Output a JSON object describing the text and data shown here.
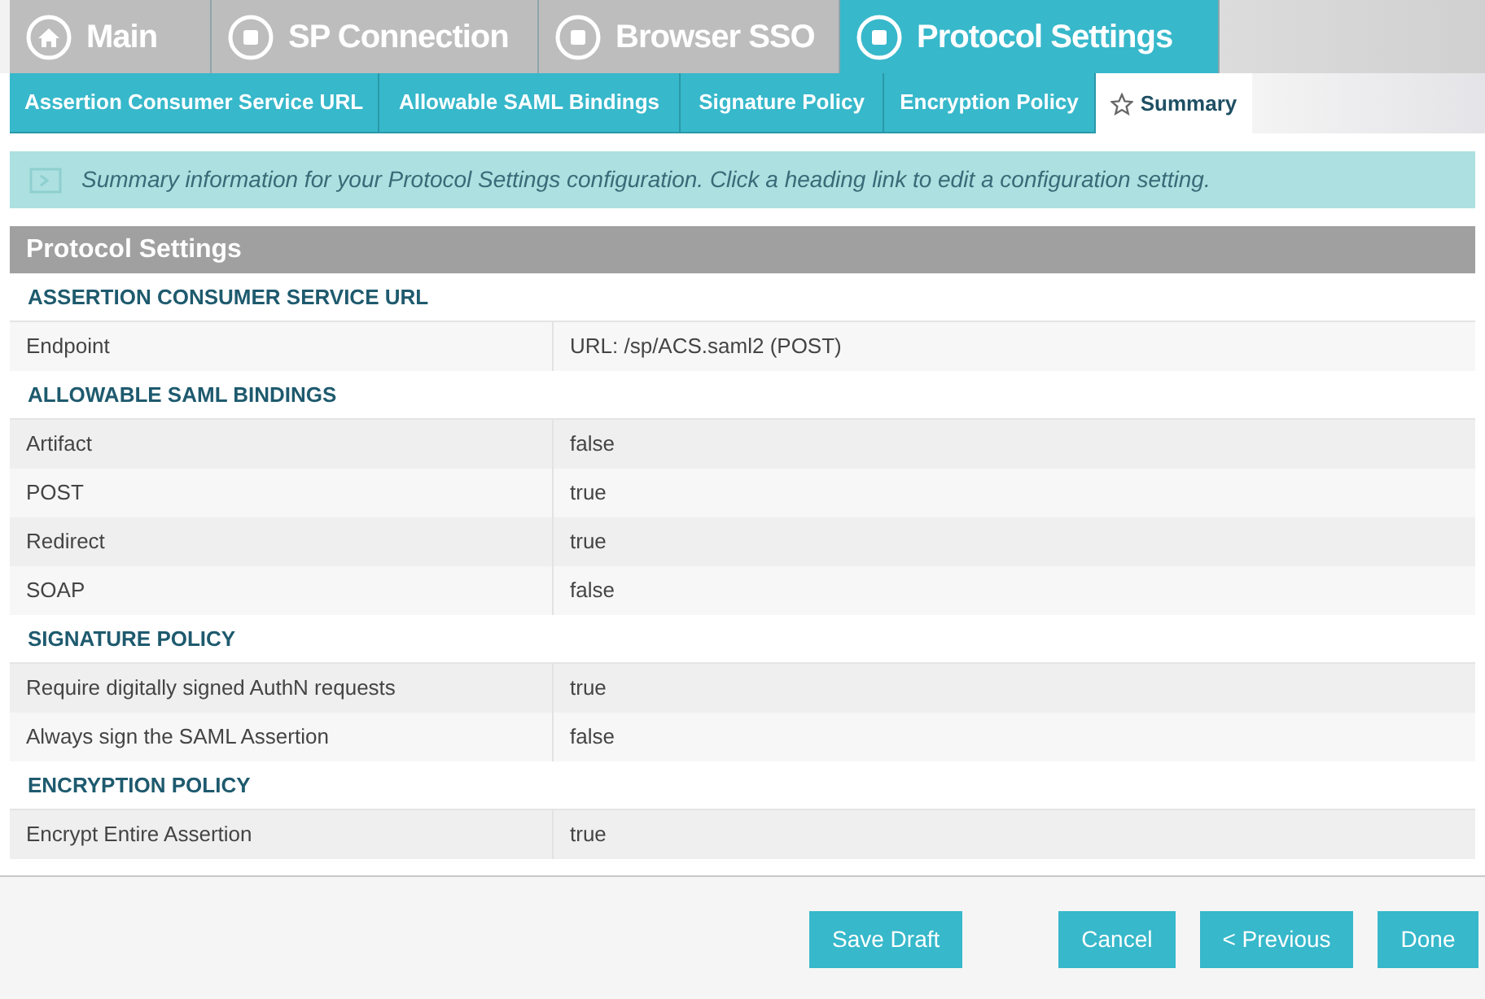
{
  "main_tabs": [
    {
      "label": "Main",
      "kind": "home",
      "selected": false
    },
    {
      "label": "SP Connection",
      "kind": "step",
      "selected": false
    },
    {
      "label": "Browser SSO",
      "kind": "step",
      "selected": false
    },
    {
      "label": "Protocol Settings",
      "kind": "step",
      "selected": true
    }
  ],
  "sub_tabs": [
    {
      "label": "Assertion Consumer Service URL",
      "selected": false
    },
    {
      "label": "Allowable SAML Bindings",
      "selected": false
    },
    {
      "label": "Signature Policy",
      "selected": false
    },
    {
      "label": "Encryption Policy",
      "selected": false
    },
    {
      "label": "Summary",
      "selected": true
    }
  ],
  "info": "Summary information for your Protocol Settings configuration. Click a heading link to edit a configuration setting.",
  "panel_title": "Protocol Settings",
  "sections": [
    {
      "heading": "ASSERTION CONSUMER SERVICE URL",
      "rows": [
        {
          "label": "Endpoint",
          "value": "URL: /sp/ACS.saml2 (POST)"
        }
      ]
    },
    {
      "heading": "ALLOWABLE SAML BINDINGS",
      "rows": [
        {
          "label": "Artifact",
          "value": "false"
        },
        {
          "label": "POST",
          "value": "true"
        },
        {
          "label": "Redirect",
          "value": "true"
        },
        {
          "label": "SOAP",
          "value": "false"
        }
      ]
    },
    {
      "heading": "SIGNATURE POLICY",
      "rows": [
        {
          "label": "Require digitally signed AuthN requests",
          "value": "true"
        },
        {
          "label": "Always sign the SAML Assertion",
          "value": "false"
        }
      ]
    },
    {
      "heading": "ENCRYPTION POLICY",
      "rows": [
        {
          "label": "Encrypt Entire Assertion",
          "value": "true"
        }
      ]
    }
  ],
  "buttons": [
    "Save Draft",
    "Cancel",
    "< Previous",
    "Done"
  ]
}
